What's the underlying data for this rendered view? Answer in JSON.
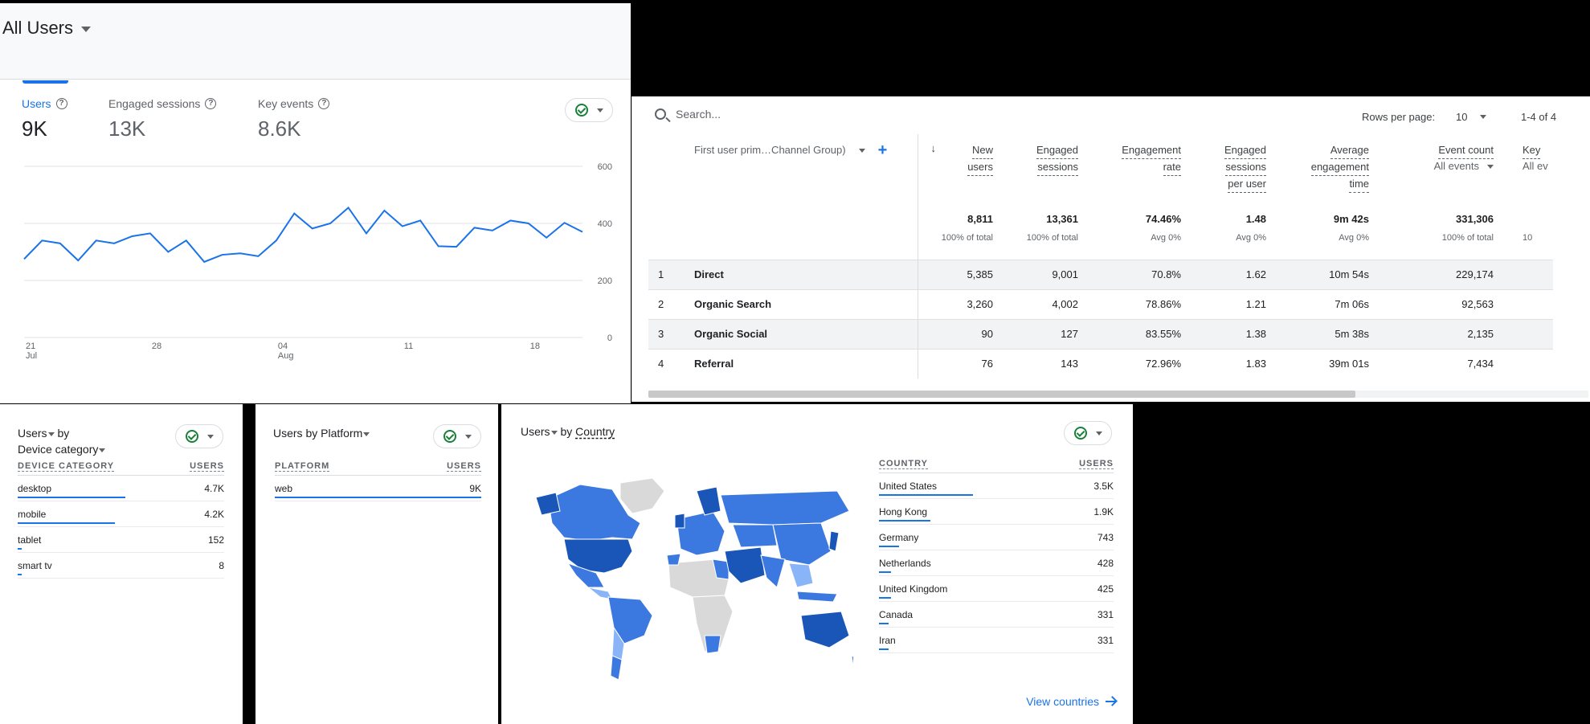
{
  "header": {
    "title": "All Users"
  },
  "metrics": [
    {
      "label": "Users",
      "value": "9K",
      "active": true
    },
    {
      "label": "Engaged sessions",
      "value": "13K",
      "active": false
    },
    {
      "label": "Key events",
      "value": "8.6K",
      "active": false
    }
  ],
  "chart_data": {
    "type": "line",
    "y_ticks": [
      "600",
      "400",
      "200",
      "0"
    ],
    "ylim": [
      0,
      600
    ],
    "x_ticks": [
      {
        "day": "21",
        "month": "Jul"
      },
      {
        "day": "28",
        "month": ""
      },
      {
        "day": "04",
        "month": "Aug"
      },
      {
        "day": "11",
        "month": ""
      },
      {
        "day": "18",
        "month": ""
      }
    ],
    "series": [
      {
        "color": "#1a73e8",
        "values": [
          275,
          340,
          330,
          270,
          340,
          330,
          355,
          365,
          300,
          340,
          265,
          290,
          295,
          285,
          340,
          435,
          382,
          400,
          455,
          365,
          445,
          390,
          410,
          320,
          318,
          385,
          375,
          410,
          400,
          350,
          402,
          370
        ]
      }
    ],
    "grid": true
  },
  "table": {
    "search_placeholder": "Search...",
    "rows_per_page_label": "Rows per page:",
    "rows_per_page": "10",
    "range": "1-4 of 4",
    "dimension": "First user prim…Channel Group)",
    "columns": [
      {
        "label": [
          "New",
          "users"
        ],
        "total": "8,811",
        "sub": "100% of total"
      },
      {
        "label": [
          "Engaged",
          "sessions"
        ],
        "total": "13,361",
        "sub": "100% of total"
      },
      {
        "label": [
          "Engagement",
          "rate"
        ],
        "total": "74.46%",
        "sub": "Avg 0%"
      },
      {
        "label": [
          "Engaged",
          "sessions",
          "per user"
        ],
        "total": "1.48",
        "sub": "Avg 0%"
      },
      {
        "label": [
          "Average",
          "engagement",
          "time"
        ],
        "total": "9m 42s",
        "sub": "Avg 0%"
      },
      {
        "label": [
          "Event count"
        ],
        "selector": "All events",
        "total": "331,306",
        "sub": "100% of total"
      },
      {
        "label": [
          "Key"
        ],
        "selector": "All ev",
        "total": "",
        "sub": "10"
      }
    ],
    "rows": [
      {
        "idx": "1",
        "name": "Direct",
        "cells": [
          "5,385",
          "9,001",
          "70.8%",
          "1.62",
          "10m 54s",
          "229,174",
          ""
        ]
      },
      {
        "idx": "2",
        "name": "Organic Search",
        "cells": [
          "3,260",
          "4,002",
          "78.86%",
          "1.21",
          "7m 06s",
          "92,563",
          ""
        ]
      },
      {
        "idx": "3",
        "name": "Organic Social",
        "cells": [
          "90",
          "127",
          "83.55%",
          "1.38",
          "5m 38s",
          "2,135",
          ""
        ]
      },
      {
        "idx": "4",
        "name": "Referral",
        "cells": [
          "76",
          "143",
          "72.96%",
          "1.83",
          "39m 01s",
          "7,434",
          ""
        ]
      }
    ]
  },
  "device": {
    "title_a": "Users",
    "title_b": "by",
    "title_c": "Device category",
    "col1": "DEVICE CATEGORY",
    "col2": "USERS",
    "items": [
      {
        "name": "desktop",
        "value": "4.7K",
        "share": 0.52
      },
      {
        "name": "mobile",
        "value": "4.2K",
        "share": 0.47
      },
      {
        "name": "tablet",
        "value": "152",
        "share": 0.02
      },
      {
        "name": "smart tv",
        "value": "8",
        "share": 0.005
      }
    ]
  },
  "platform": {
    "title_a": "Users",
    "title_b": "by",
    "title_c": "Platform",
    "col1": "PLATFORM",
    "col2": "USERS",
    "items": [
      {
        "name": "web",
        "value": "9K",
        "share": 1.0
      }
    ]
  },
  "country": {
    "title_a": "Users",
    "title_b": "by",
    "title_c": "Country",
    "col1": "COUNTRY",
    "col2": "USERS",
    "items": [
      {
        "name": "United States",
        "value": "3.5K",
        "share": 0.4
      },
      {
        "name": "Hong Kong",
        "value": "1.9K",
        "share": 0.22
      },
      {
        "name": "Germany",
        "value": "743",
        "share": 0.085
      },
      {
        "name": "Netherlands",
        "value": "428",
        "share": 0.05
      },
      {
        "name": "United Kingdom",
        "value": "425",
        "share": 0.05
      },
      {
        "name": "Canada",
        "value": "331",
        "share": 0.04
      },
      {
        "name": "Iran",
        "value": "331",
        "share": 0.04
      }
    ],
    "link": "View countries",
    "colors": {
      "high": "#1a56b8",
      "mid": "#3b78e0",
      "low": "#8ab4f8",
      "none": "#d9d9d9"
    }
  }
}
